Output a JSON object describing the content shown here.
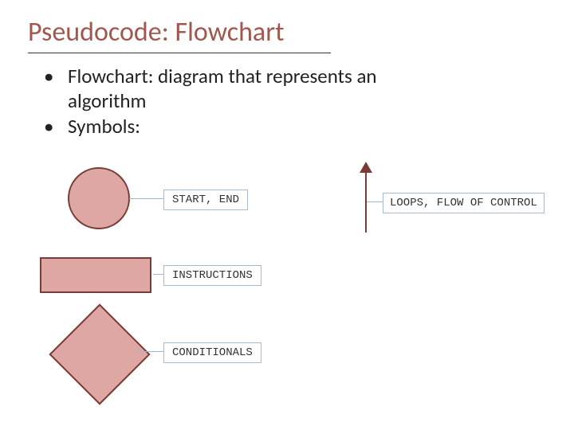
{
  "title": "Pseudocode: Flowchart",
  "bullets": {
    "item1_line1": "Flowchart: diagram that represents an",
    "item1_line2": "algorithm",
    "item2": "Symbols:"
  },
  "symbols": {
    "terminal": {
      "label": "START, END",
      "shape": "circle"
    },
    "process": {
      "label": "INSTRUCTIONS",
      "shape": "rectangle"
    },
    "decision": {
      "label": "CONDITIONALS",
      "shape": "diamond"
    },
    "flow": {
      "label": "LOOPS, FLOW OF CONTROL",
      "shape": "arrow"
    }
  },
  "colors": {
    "title": "#a2574e",
    "shape_fill": "#dfa7a3",
    "shape_stroke": "#7a3c36",
    "label_border": "#a6bcd4"
  }
}
